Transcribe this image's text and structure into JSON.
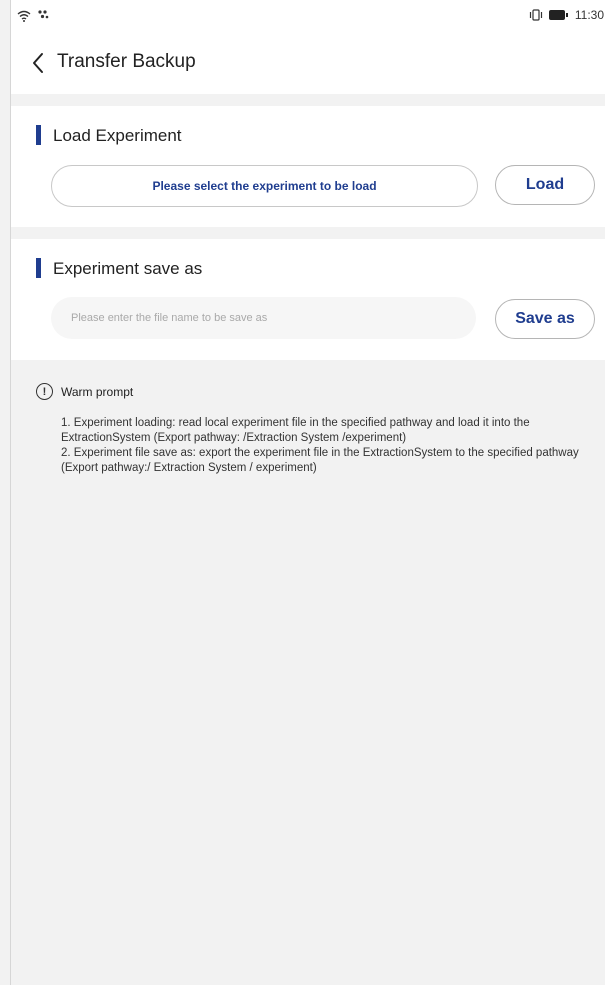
{
  "status_bar": {
    "time": "11:30",
    "left_icons": [
      "wifi-icon",
      "signal-icon"
    ],
    "right_icons": [
      "vibrate-icon",
      "battery-icon"
    ]
  },
  "header": {
    "back_icon": "chevron-left-icon",
    "title": "Transfer Backup"
  },
  "load_section": {
    "title": "Load Experiment",
    "field_text": "Please select the experiment to be load",
    "button_label": "Load"
  },
  "save_section": {
    "title": "Experiment save as",
    "input_placeholder": "Please enter the file name to be save as",
    "input_value": "",
    "button_label": "Save as"
  },
  "prompt": {
    "icon": "alert-icon",
    "title": "Warm prompt",
    "lines": [
      "1. Experiment loading: read local experiment file in the specified pathway and load it into the ExtractionSystem (Export pathway: /Extraction System /experiment)",
      "2. Experiment file save as: export the experiment file in the ExtractionSystem to the specified pathway (Export pathway:/ Extraction System / experiment)"
    ]
  },
  "colors": {
    "accent": "#1f3d8f",
    "page_background": "#f2f2f2",
    "card_background": "#ffffff"
  }
}
